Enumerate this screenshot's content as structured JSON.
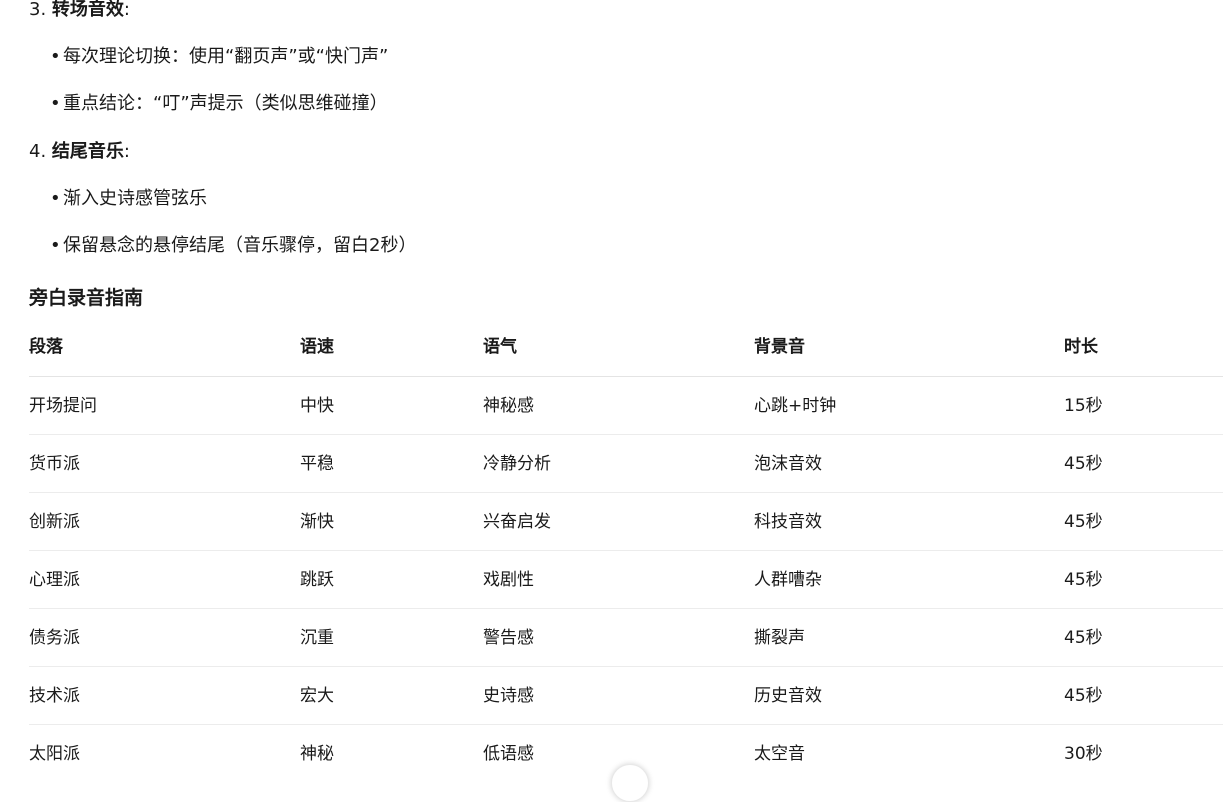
{
  "sections": [
    {
      "number": "3.",
      "title": "转场音效",
      "colon": ":",
      "items": [
        "每次理论切换：使用“翻页声”或“快门声”",
        "重点结论：“叮”声提示（类似思维碰撞）"
      ]
    },
    {
      "number": "4.",
      "title": "结尾音乐",
      "colon": ":",
      "items": [
        "渐入史诗感管弦乐",
        "保留悬念的悬停结尾（音乐骤停，留白2秒）"
      ]
    }
  ],
  "bullet_char": "•",
  "guide_title": "旁白录音指南",
  "table": {
    "headers": [
      "段落",
      "语速",
      "语气",
      "背景音",
      "时长"
    ],
    "rows": [
      [
        "开场提问",
        "中快",
        "神秘感",
        "心跳+时钟",
        "15秒"
      ],
      [
        "货币派",
        "平稳",
        "冷静分析",
        "泡沫音效",
        "45秒"
      ],
      [
        "创新派",
        "渐快",
        "兴奋启发",
        "科技音效",
        "45秒"
      ],
      [
        "心理派",
        "跳跃",
        "戏剧性",
        "人群嘈杂",
        "45秒"
      ],
      [
        "债务派",
        "沉重",
        "警告感",
        "撕裂声",
        "45秒"
      ],
      [
        "技术派",
        "宏大",
        "史诗感",
        "历史音效",
        "45秒"
      ],
      [
        "太阳派",
        "神秘",
        "低语感",
        "太空音",
        "30秒"
      ]
    ]
  }
}
